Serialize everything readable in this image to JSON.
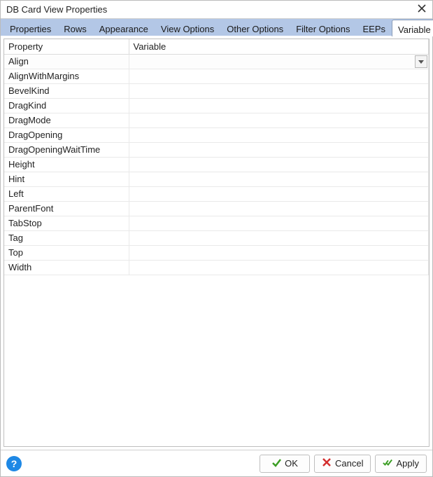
{
  "title": "DB Card View Properties",
  "tabs": [
    {
      "label": "Properties",
      "active": false
    },
    {
      "label": "Rows",
      "active": false
    },
    {
      "label": "Appearance",
      "active": false
    },
    {
      "label": "View Options",
      "active": false
    },
    {
      "label": "Other Options",
      "active": false
    },
    {
      "label": "Filter Options",
      "active": false
    },
    {
      "label": "EEPs",
      "active": false
    },
    {
      "label": "Variable Links",
      "active": true
    }
  ],
  "grid": {
    "columns": {
      "property": "Property",
      "variable": "Variable"
    },
    "rows": [
      {
        "property": "Align",
        "variable": "",
        "selected": true
      },
      {
        "property": "AlignWithMargins",
        "variable": ""
      },
      {
        "property": "BevelKind",
        "variable": ""
      },
      {
        "property": "DragKind",
        "variable": ""
      },
      {
        "property": "DragMode",
        "variable": ""
      },
      {
        "property": "DragOpening",
        "variable": ""
      },
      {
        "property": "DragOpeningWaitTime",
        "variable": ""
      },
      {
        "property": "Height",
        "variable": ""
      },
      {
        "property": "Hint",
        "variable": ""
      },
      {
        "property": "Left",
        "variable": ""
      },
      {
        "property": "ParentFont",
        "variable": ""
      },
      {
        "property": "TabStop",
        "variable": ""
      },
      {
        "property": "Tag",
        "variable": ""
      },
      {
        "property": "Top",
        "variable": ""
      },
      {
        "property": "Width",
        "variable": ""
      }
    ]
  },
  "buttons": {
    "help": "?",
    "ok": "OK",
    "cancel": "Cancel",
    "apply": "Apply"
  }
}
